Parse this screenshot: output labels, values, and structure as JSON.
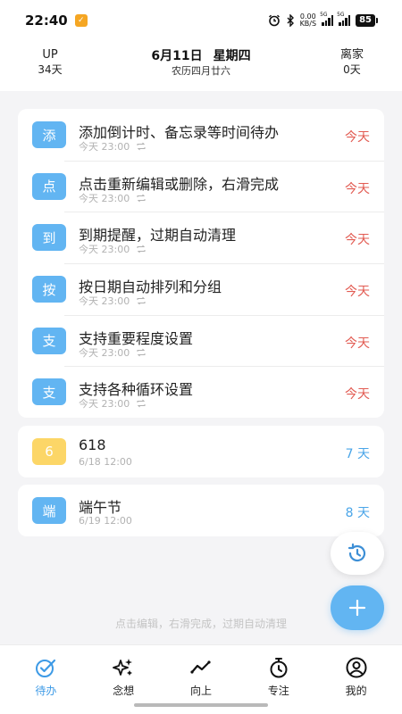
{
  "status_bar": {
    "time": "22:40",
    "speed_value": "0.00",
    "speed_unit": "KB/S",
    "net1": "5G",
    "net2": "5G",
    "battery": "85"
  },
  "header": {
    "up_label": "UP",
    "up_days": "34天",
    "date": "6月11日",
    "weekday": "星期四",
    "lunar": "农历四月廿六",
    "away_label": "离家",
    "away_days": "0天"
  },
  "main_list": [
    {
      "badge": "添",
      "title": "添加倒计时、备忘录等时间待办",
      "meta": "今天 23:00",
      "when": "今天"
    },
    {
      "badge": "点",
      "title": "点击重新编辑或删除，右滑完成",
      "meta": "今天 23:00",
      "when": "今天"
    },
    {
      "badge": "到",
      "title": "到期提醒，过期自动清理",
      "meta": "今天 23:00",
      "when": "今天"
    },
    {
      "badge": "按",
      "title": "按日期自动排列和分组",
      "meta": "今天 23:00",
      "when": "今天"
    },
    {
      "badge": "支",
      "title": "支持重要程度设置",
      "meta": "今天 23:00",
      "when": "今天"
    },
    {
      "badge": "支",
      "title": "支持各种循环设置",
      "meta": "今天 23:00",
      "when": "今天"
    }
  ],
  "item_618": {
    "badge": "6",
    "title": "618",
    "meta": "6/18 12:00",
    "when": "7 天"
  },
  "item_dw": {
    "badge": "端",
    "title": "端午节",
    "meta": "6/19 12:00",
    "when": "8 天"
  },
  "hint": "点击编辑，右滑完成，过期自动清理",
  "nav": [
    {
      "label": "待办",
      "icon": "check-circle-icon"
    },
    {
      "label": "念想",
      "icon": "sparkle-icon"
    },
    {
      "label": "向上",
      "icon": "trend-icon"
    },
    {
      "label": "专注",
      "icon": "stopwatch-icon"
    },
    {
      "label": "我的",
      "icon": "user-icon"
    }
  ],
  "colors": {
    "accent": "#62b5f2",
    "today_red": "#e25b52",
    "future_blue": "#4aa5e8",
    "badge_yellow": "#fcd667"
  }
}
